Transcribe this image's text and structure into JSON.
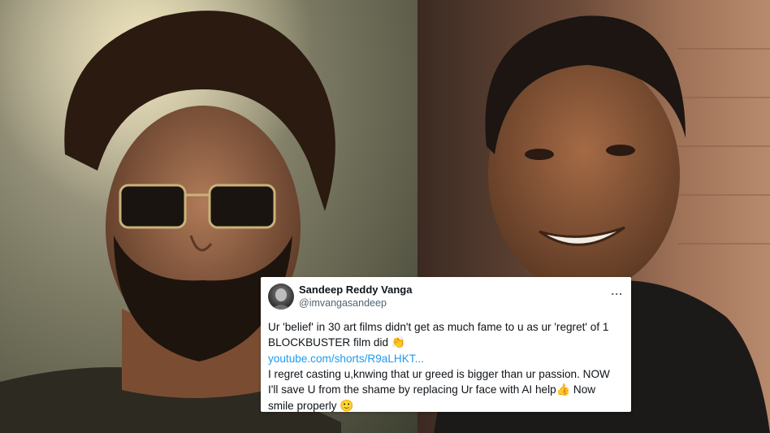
{
  "tweet": {
    "display_name": "Sandeep Reddy Vanga",
    "handle": "@imvangasandeep",
    "more_icon": "...",
    "line1": "Ur 'belief' in 30 art films didn't get as much fame to u as ur 'regret' of 1 BLOCKBUSTER film did",
    "clap_emoji": "👏",
    "link": "youtube.com/shorts/R9aLHKT...",
    "line2": "I regret casting u,knwing that ur greed is bigger than ur passion. NOW I'll save U from the shame by replacing Ur face with AI help",
    "thumbs_emoji": "👍",
    "line3": " Now smile properly",
    "smile_emoji": "🙂"
  },
  "colors": {
    "link": "#1d9bf0",
    "text": "#0f1419",
    "secondary": "#536471"
  }
}
